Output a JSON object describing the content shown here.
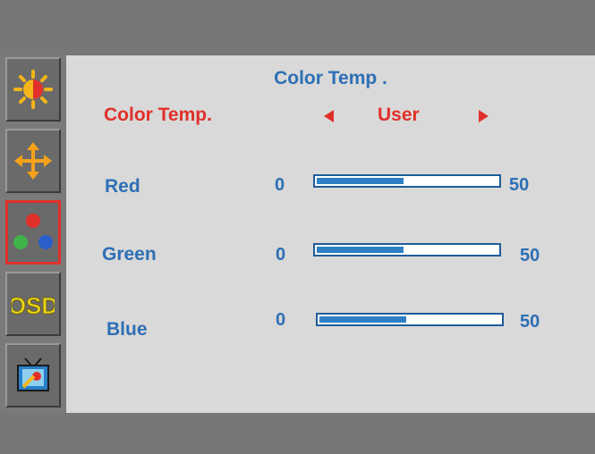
{
  "menu": {
    "title": "Color Temp .",
    "setting": {
      "label": "Color Temp.",
      "value": "User"
    },
    "sliders": [
      {
        "label": "Red",
        "min": "0",
        "max": "50",
        "value": 24
      },
      {
        "label": "Green",
        "min": "0",
        "max": "50",
        "value": 24
      },
      {
        "label": "Blue",
        "min": "0",
        "max": "50",
        "value": 24
      }
    ]
  },
  "sidebar": {
    "icons": [
      "brightness-icon",
      "position-icon",
      "color-icon",
      "osd-icon",
      "setup-icon"
    ],
    "osd_text": "OSD"
  },
  "colors": {
    "accent": "#e0302a",
    "text": "#2d6fb5",
    "bar_fill": "#2d80c4"
  }
}
